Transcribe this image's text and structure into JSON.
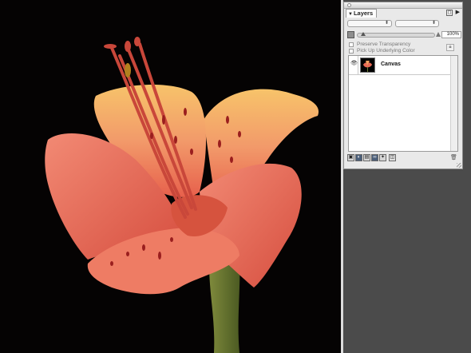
{
  "panel": {
    "tab_title": "Layers",
    "options_icon": "palette-options-icon",
    "menu_icon": "palette-menu-arrow-icon",
    "blend_mode_value": "",
    "composite_value": "",
    "opacity_value": "100%",
    "preserve_transparency_label": "Preserve Transparency",
    "pick_up_underlying_label": "Pick Up Underlying Color",
    "layers": [
      {
        "name": "Canvas",
        "visible": true,
        "locked": true
      }
    ],
    "bottom_buttons": [
      "new-layer-icon",
      "layer-mask-icon",
      "group-icon",
      "link-icon",
      "effects-icon",
      "dynamic-plugin-icon",
      "trash-icon"
    ]
  },
  "canvas": {
    "image": "flower-photo",
    "background_color": "#050303",
    "petal_color": "#e86a55",
    "workspace_color": "#4b4b4b"
  }
}
